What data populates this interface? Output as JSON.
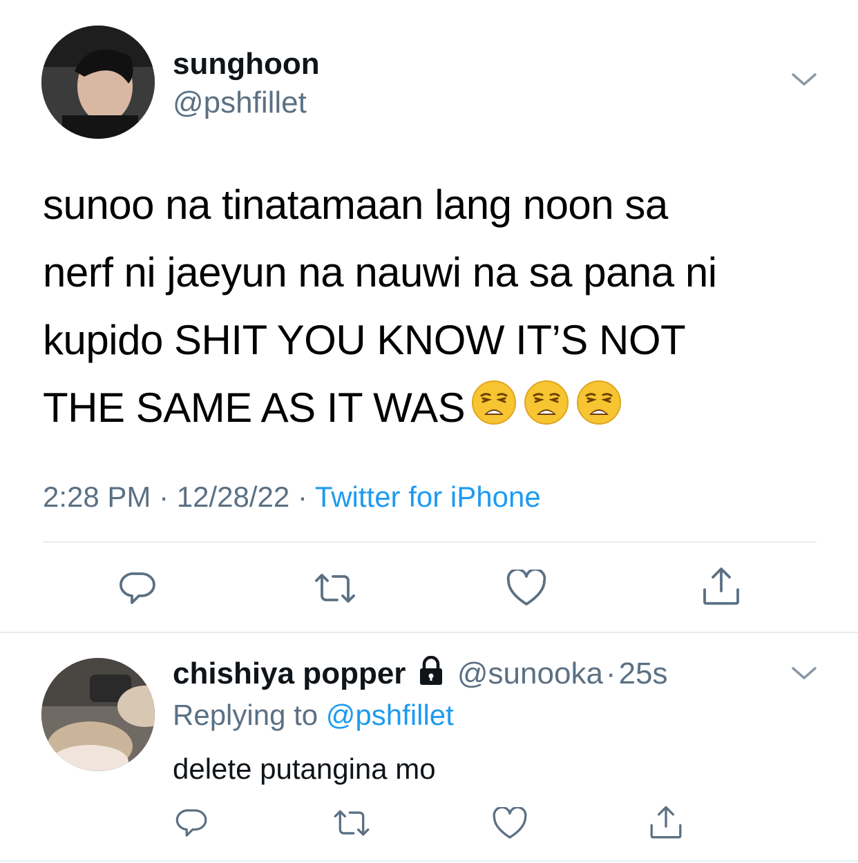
{
  "tweet": {
    "author": {
      "display_name": "sunghoon",
      "handle": "@pshfillet"
    },
    "text_lines": [
      "sunoo na tinatamaan lang noon sa",
      "nerf ni jaeyun na nauwi na sa pana ni",
      "kupido SHIT YOU KNOW IT’S NOT",
      "THE SAME AS IT WAS"
    ],
    "emojis": [
      "weary-face",
      "weary-face",
      "weary-face"
    ],
    "time": "2:28 PM",
    "date": "12/28/22",
    "separator": "·",
    "source": "Twitter for iPhone",
    "actions": [
      "reply-icon",
      "retweet-icon",
      "like-icon",
      "share-icon"
    ]
  },
  "reply": {
    "author": {
      "display_name": "chishiya popper",
      "handle": "@sunooka",
      "protected": true
    },
    "time_ago": "25s",
    "separator": "·",
    "replying_to_label": "Replying to",
    "replying_to_handle": "@pshfillet",
    "text": "delete putangina mo",
    "actions": [
      "reply-icon",
      "retweet-icon",
      "like-icon",
      "share-icon"
    ]
  },
  "colors": {
    "secondary_text": "#5b7083",
    "link": "#1d9bf0",
    "divider": "#e6ecf0"
  }
}
